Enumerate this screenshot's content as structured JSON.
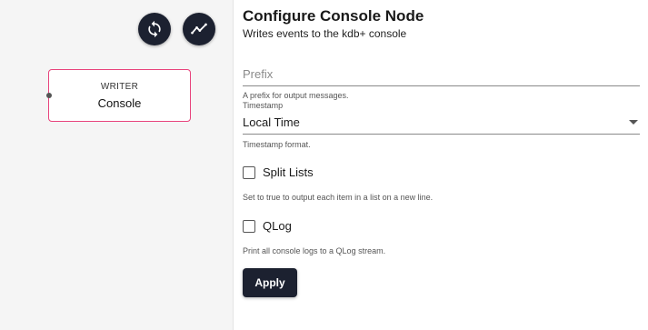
{
  "canvas": {
    "toolbar": {
      "sync_icon": "sync-icon",
      "trend_icon": "trend-icon"
    },
    "node": {
      "type": "WRITER",
      "name": "Console",
      "border_color": "#e8447c"
    }
  },
  "panel": {
    "title": "Configure Console Node",
    "subtitle": "Writes events to the kdb+ console",
    "prefix": {
      "placeholder": "Prefix",
      "value": "",
      "hint": "A prefix for output messages."
    },
    "timestamp": {
      "label": "Timestamp",
      "value": "Local Time",
      "hint": "Timestamp format."
    },
    "split_lists": {
      "label": "Split Lists",
      "checked": false,
      "hint": "Set to true to output each item in a list on a new line."
    },
    "qlog": {
      "label": "QLog",
      "checked": false,
      "hint": "Print all console logs to a QLog stream."
    },
    "apply_label": "Apply"
  },
  "colors": {
    "button_dark": "#1c2130",
    "node_accent": "#e8447c"
  }
}
